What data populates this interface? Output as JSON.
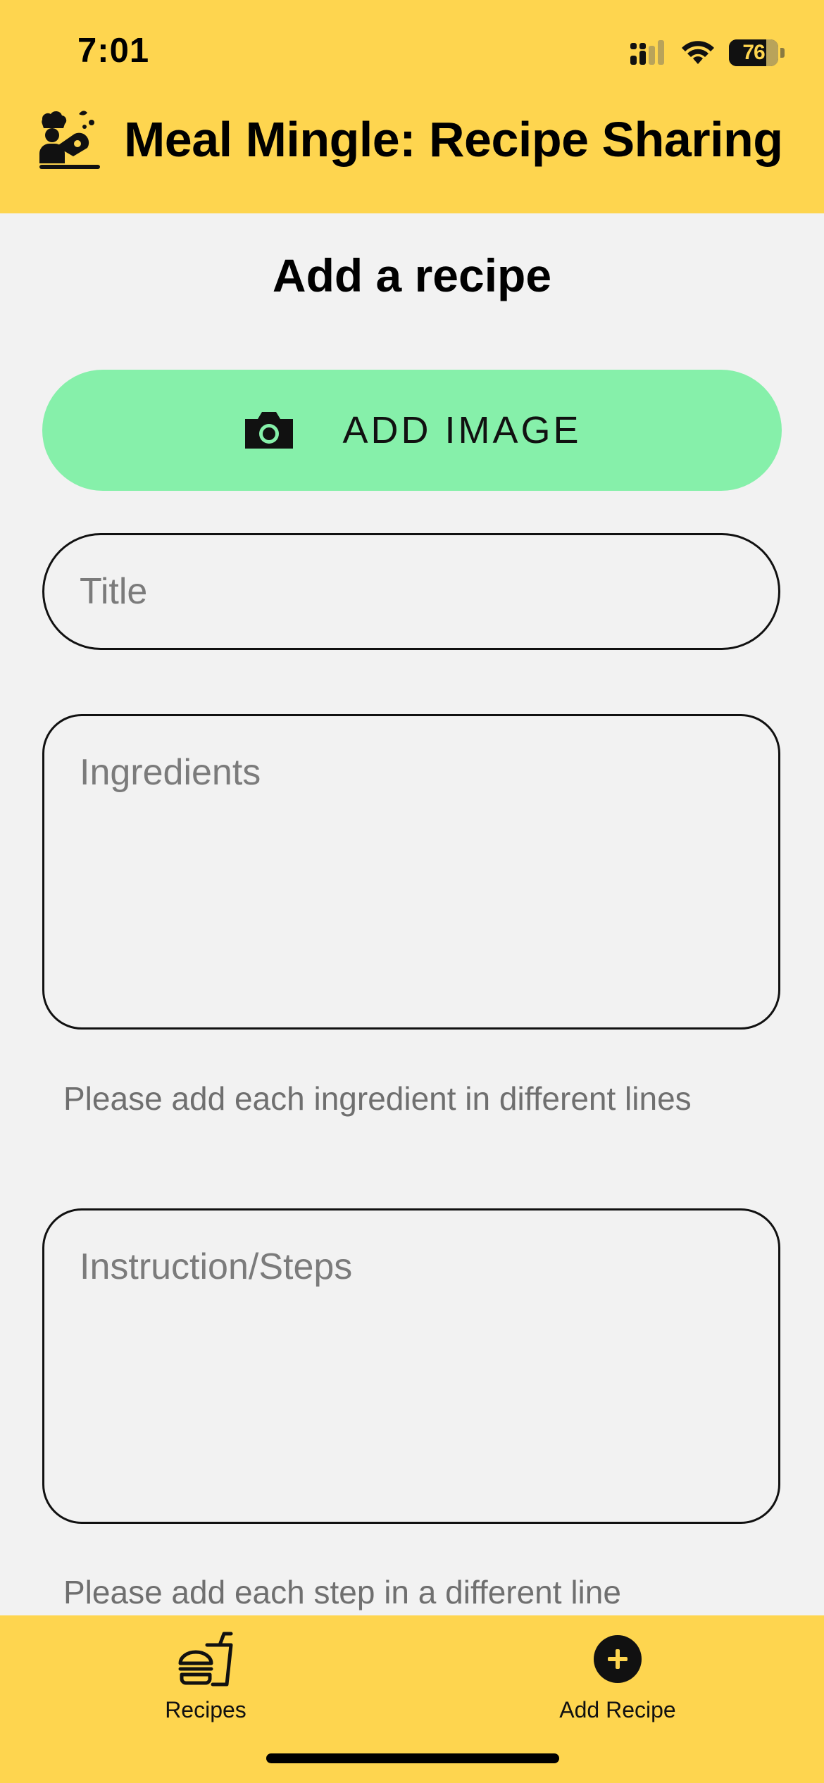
{
  "status_bar": {
    "time": "7:01",
    "battery_level": "76",
    "battery_fraction": 0.76,
    "icons": [
      "cellular-signal-icon",
      "wifi-icon",
      "battery-icon"
    ]
  },
  "header": {
    "logo_icon": "chef-cooking-logo-icon",
    "title": "Meal Mingle: Recipe Sharing"
  },
  "form": {
    "page_title": "Add a recipe",
    "add_image": {
      "icon": "camera-icon",
      "label": "ADD IMAGE"
    },
    "title_field": {
      "value": "",
      "placeholder": "Title"
    },
    "ingredients_field": {
      "value": "",
      "placeholder": "Ingredients",
      "hint": "Please add each ingredient in different lines"
    },
    "steps_field": {
      "value": "",
      "placeholder": "Instruction/Steps",
      "hint": "Please add each step in a different line"
    }
  },
  "tabbar": {
    "tabs": [
      {
        "label": "Recipes",
        "icon": "burger-drink-icon"
      },
      {
        "label": "Add Recipe",
        "icon": "plus-circle-icon",
        "active": true
      }
    ]
  },
  "colors": {
    "header_bg": "#fed54f",
    "page_bg": "#f2f2f2",
    "add_image_bg": "#86f0aa",
    "placeholder_text": "#7b7b7b",
    "hint_text": "#6f6f6f"
  }
}
